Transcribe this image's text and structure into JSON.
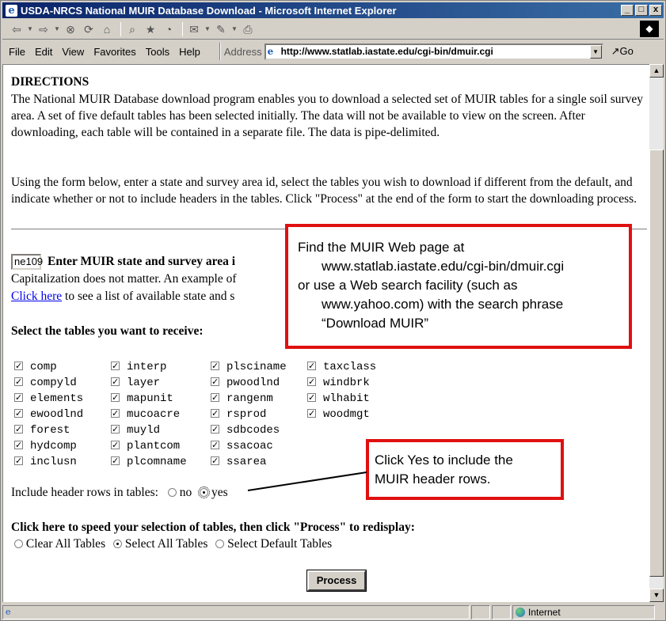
{
  "window": {
    "title": "USDA-NRCS National MUIR Database Download - Microsoft Internet Explorer",
    "controls": [
      "_",
      "□",
      "x"
    ]
  },
  "menu": {
    "items": [
      "File",
      "Edit",
      "View",
      "Favorites",
      "Tools",
      "Help"
    ],
    "address_label": "Address",
    "address_value": "http://www.statlab.iastate.edu/cgi-bin/dmuir.cgi",
    "go_label": "Go"
  },
  "page": {
    "heading": "DIRECTIONS",
    "para1": "The National MUIR Database download program enables you to download a selected set of MUIR tables for a single soil survey area. A set of five default tables has been selected initially. The data will not be available to view on the screen. After downloading, each table will be contained in a separate file. The data is pipe-delimited.",
    "para2": "Using the form below, enter a state and survey area id, select the tables you wish to download if different from the default, and indicate whether or not to include headers in the tables. Click \"Process\" at the end of the form to start the downloading process.",
    "state_input_value": "ne109",
    "state_label": "Enter MUIR state and survey area i",
    "cap_text": "Capitalization does not matter. An example of",
    "click_here": "Click here",
    "click_here_rest": " to see a list of available state and s",
    "tables_heading": "Select the tables you want to receive:",
    "tables": [
      [
        "comp",
        "compyld",
        "elements",
        "ewoodlnd",
        "forest",
        "hydcomp",
        "inclusn"
      ],
      [
        "interp",
        "layer",
        "mapunit",
        "mucoacre",
        "muyld",
        "plantcom",
        "plcomname"
      ],
      [
        "plsciname",
        "pwoodlnd",
        "rangenm",
        "rsprod",
        "sdbcodes",
        "ssacoac",
        "ssarea"
      ],
      [
        "taxclass",
        "windbrk",
        "wlhabit",
        "woodmgt"
      ]
    ],
    "header_rows_label": "Include header rows in tables:",
    "header_no": "no",
    "header_yes": "yes",
    "speed_heading": "Click here to speed your selection of tables, then click \"Process\" to redisplay:",
    "opt_clear": "Clear All Tables",
    "opt_select_all": "Select All Tables",
    "opt_default": "Select Default Tables",
    "process_label": "Process"
  },
  "callouts": {
    "c1_line1": "Find the MUIR Web page at",
    "c1_line2": "www.statlab.iastate.edu/cgi-bin/dmuir.cgi",
    "c1_line3": "or use a Web search facility (such as",
    "c1_line4": "www.yahoo.com) with the search phrase",
    "c1_line5": "“Download MUIR”",
    "c2_line1": "Click Yes to include the",
    "c2_line2": "MUIR header rows."
  },
  "status": {
    "zone": "Internet"
  },
  "colors": {
    "titlebar": "#0a246a",
    "callout_border": "#e01010",
    "link": "#0000ee"
  }
}
